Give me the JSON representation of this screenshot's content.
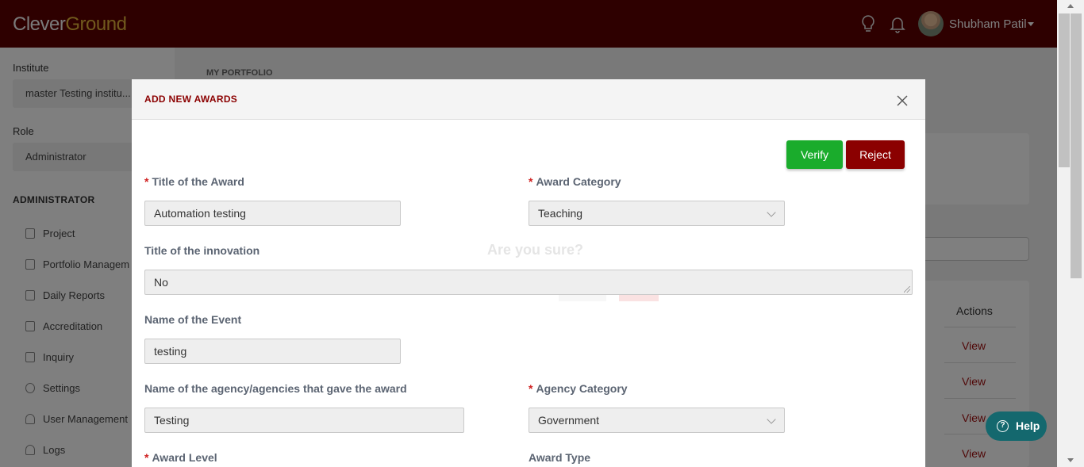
{
  "app": {
    "logo_part1": "Clever",
    "logo_part2": "Ground"
  },
  "header": {
    "user_name": "Shubham Patil"
  },
  "sidebar": {
    "institute_label": "Institute",
    "institute_value": "master Testing institu...",
    "role_label": "Role",
    "role_value": "Administrator",
    "section_heading": "ADMINISTRATOR",
    "items": [
      {
        "label": "Project"
      },
      {
        "label": "Portfolio Managem"
      },
      {
        "label": "Daily Reports"
      },
      {
        "label": "Accreditation"
      },
      {
        "label": "Inquiry"
      },
      {
        "label": "Settings"
      },
      {
        "label": "User Management"
      },
      {
        "label": "Logs"
      }
    ]
  },
  "main": {
    "page_label": "MY PORTFOLIO",
    "actions_header": "Actions",
    "view_link": "View"
  },
  "modal": {
    "title": "ADD NEW AWARDS",
    "verify_label": "Verify",
    "reject_label": "Reject",
    "fields": {
      "award_title_label": "Title of the Award",
      "award_title_value": "Automation testing",
      "award_category_label": "Award Category",
      "award_category_value": "Teaching",
      "innovation_label": "Title of the innovation",
      "innovation_value": "No",
      "event_label": "Name of the Event",
      "event_value": "testing",
      "agency_label": "Name of the agency/agencies that gave the award",
      "agency_value": "Testing",
      "agency_category_label": "Agency Category",
      "agency_category_value": "Government",
      "award_level_label": "Award Level",
      "award_type_label": "Award Type"
    },
    "required_marker": "*"
  },
  "confirm_ghost": {
    "text": "Are you sure?"
  },
  "help": {
    "label": "Help"
  },
  "colors": {
    "header_bg": "#5c0000",
    "accent_red": "#8b0000",
    "verify_green": "#1aac2c",
    "help_teal": "#14686e"
  }
}
